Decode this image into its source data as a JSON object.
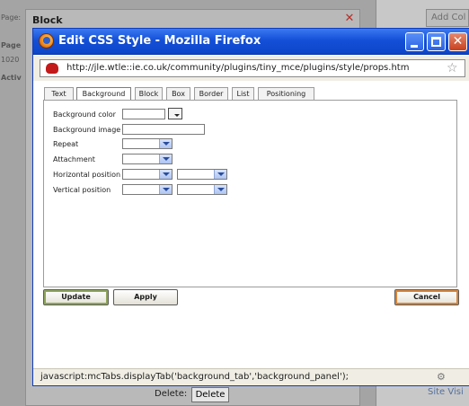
{
  "background": {
    "block_title": "Block",
    "left_labels": [
      "Page:",
      "Page",
      "1020",
      "Activ"
    ],
    "add_button": "Add Col",
    "site_visit": "Site Visi",
    "delete_label": "Delete:",
    "delete_button": "Delete"
  },
  "window": {
    "title": "Edit CSS Style - Mozilla Firefox",
    "url": "http://jle.wtle::ie.co.uk/community/plugins/tiny_mce/plugins/style/props.htm"
  },
  "tabs": [
    "Text",
    "Background",
    "Block",
    "Box",
    "Border",
    "List",
    "Positioning"
  ],
  "active_tab": "Background",
  "form": {
    "background_color_label": "Background color",
    "background_image_label": "Background image",
    "repeat_label": "Repeat",
    "attachment_label": "Attachment",
    "horizontal_position_label": "Horizontal position",
    "vertical_position_label": "Vertical position"
  },
  "buttons": {
    "update": "Update",
    "apply": "Apply",
    "cancel": "Cancel"
  },
  "status": {
    "text": "javascript:mcTabs.displayTab('background_tab','background_panel');"
  }
}
